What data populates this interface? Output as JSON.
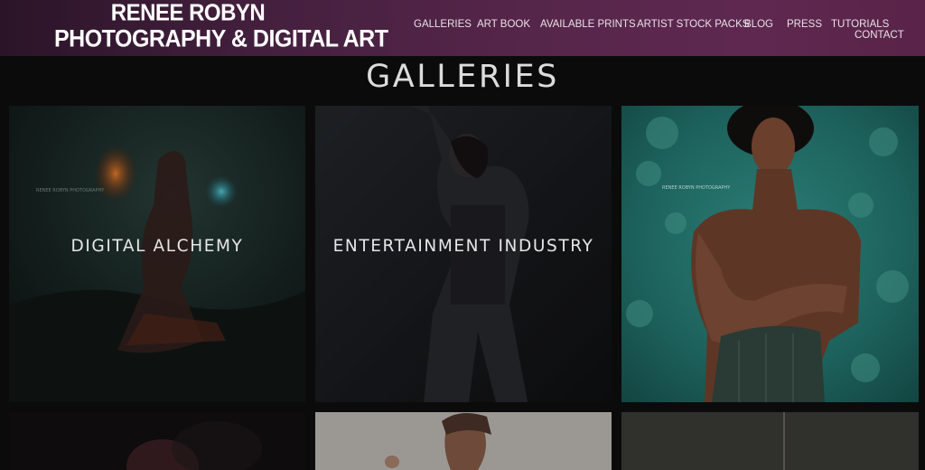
{
  "site": {
    "logo_line1": "RENEE ROBYN",
    "logo_line2": "PHOTOGRAPHY & DIGITAL ART"
  },
  "nav": {
    "items": [
      "GALLERIES",
      "ART BOOK",
      "AVAILABLE PRINTS",
      "ARTIST STOCK PACKS",
      "BLOG",
      "PRESS",
      "TUTORIALS",
      "CONTACT"
    ]
  },
  "main": {
    "title": "GALLERIES",
    "galleries": [
      {
        "label": "DIGITAL ALCHEMY",
        "watermark": "RENEE ROBYN PHOTOGRAPHY"
      },
      {
        "label": "ENTERTAINMENT INDUSTRY"
      },
      {
        "label": "",
        "watermark": "RENEE ROBYN PHOTOGRAPHY"
      },
      {
        "label": ""
      },
      {
        "label": ""
      },
      {
        "label": ""
      }
    ]
  },
  "colors": {
    "header_gradient_start": "#2b1428",
    "header_gradient_end": "#5e2850",
    "page_background": "#0b0b0b",
    "teal_background": "#1f6b66"
  }
}
